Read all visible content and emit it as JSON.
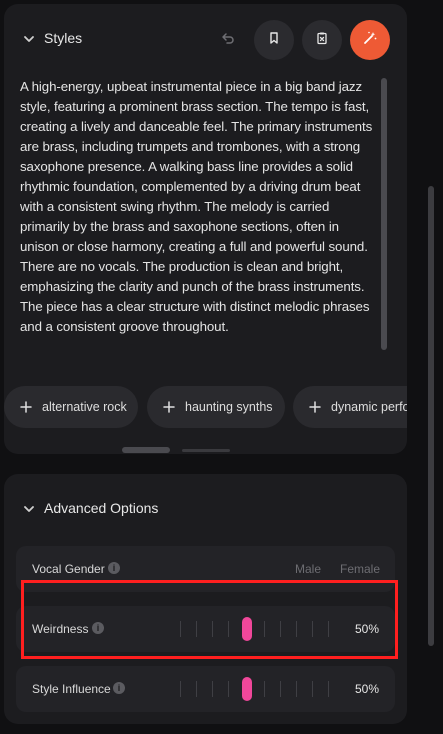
{
  "styles_panel": {
    "title": "Styles",
    "prompt": "A high-energy, upbeat instrumental piece in a big band jazz style, featuring a prominent brass section. The tempo is fast, creating a lively and danceable feel. The primary instruments are brass, including trumpets and trombones, with a strong saxophone presence. A walking bass line provides a solid rhythmic foundation, complemented by a driving drum beat with a consistent swing rhythm. The melody is carried primarily by the brass and saxophone sections, often in unison or close harmony, creating a full and powerful sound. There are no vocals. The production is clean and bright, emphasizing the clarity and punch of the brass instruments. The piece has a clear structure with distinct melodic phrases and a consistent groove throughout.",
    "tags": [
      "alternative rock",
      "haunting synths",
      "dynamic perfo"
    ],
    "magic_button_color": "#ee5a35"
  },
  "advanced": {
    "title": "Advanced Options",
    "vocal_gender": {
      "label": "Vocal Gender",
      "options": [
        "Male",
        "Female"
      ]
    },
    "weirdness": {
      "label": "Weirdness",
      "value": "50%"
    },
    "style_influence": {
      "label": "Style Influence",
      "value": "50%"
    },
    "slider_color": "#f0479a"
  },
  "highlight_color": "#ff1f1f"
}
